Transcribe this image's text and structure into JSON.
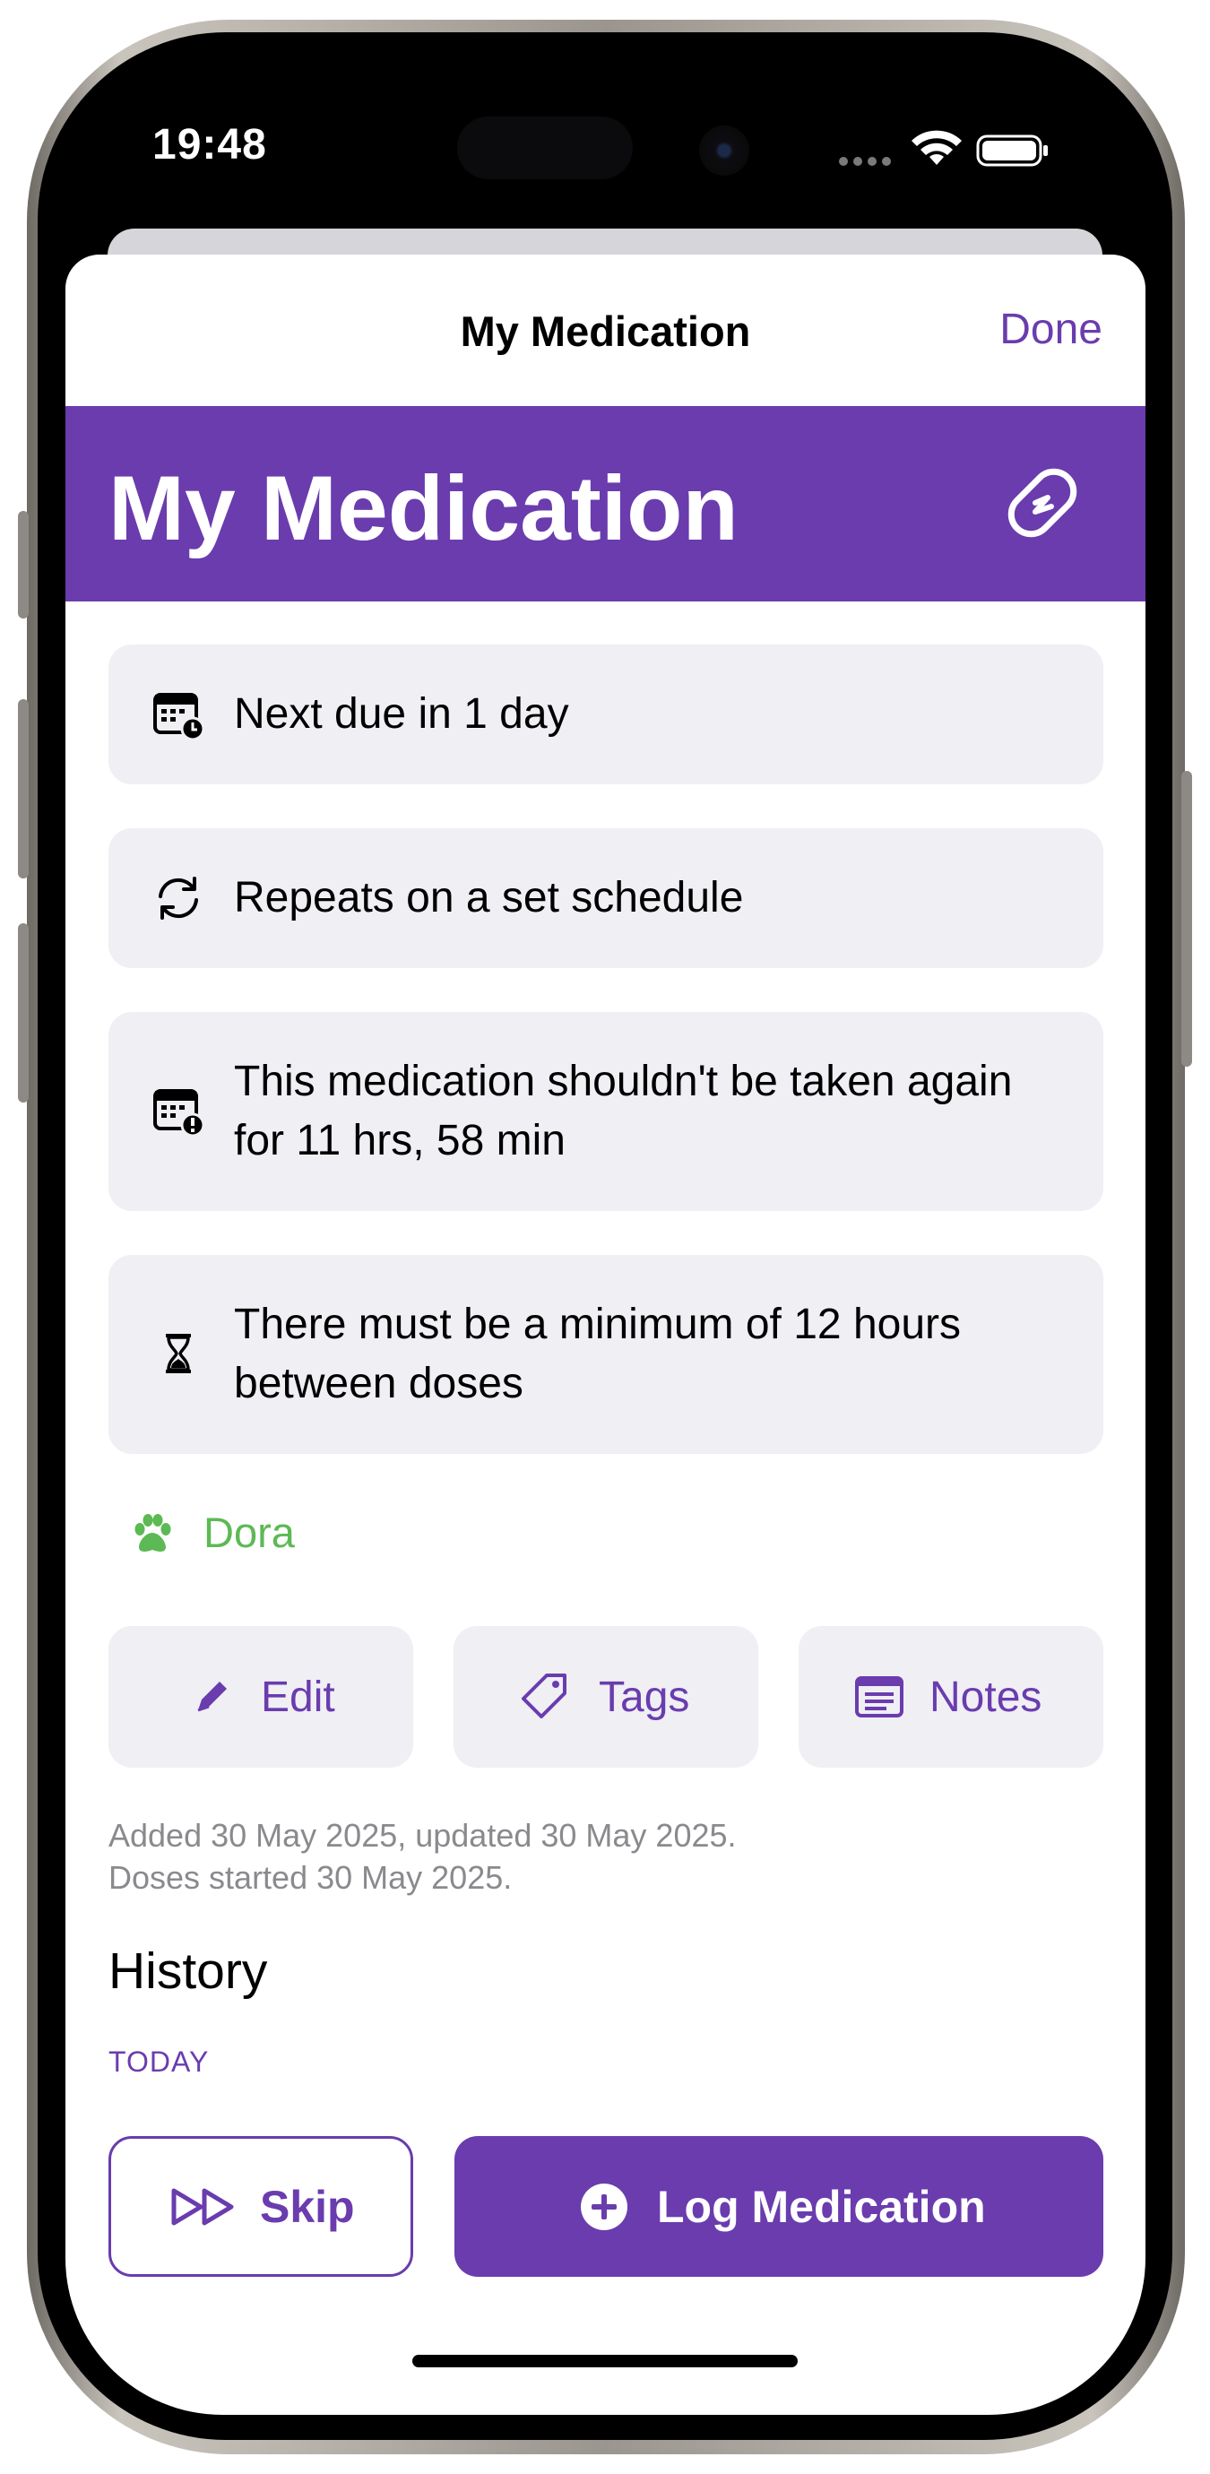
{
  "status_bar": {
    "time": "19:48"
  },
  "nav": {
    "title": "My Medication",
    "done_label": "Done"
  },
  "header": {
    "title": "My Medication",
    "icon": "pill-icon",
    "color": "#6a3cae"
  },
  "info_cards": [
    {
      "icon": "calendar-clock-icon",
      "text": "Next due in 1 day"
    },
    {
      "icon": "repeat-icon",
      "text": "Repeats on a set schedule"
    },
    {
      "icon": "calendar-alert-icon",
      "text": "This medication shouldn't be taken again for 11 hrs, 58 min"
    },
    {
      "icon": "hourglass-icon",
      "text": "There must be a minimum of 12 hours between doses"
    }
  ],
  "pet": {
    "name": "Dora",
    "icon": "paw-icon",
    "color": "#5db954"
  },
  "actions": {
    "edit_label": "Edit",
    "tags_label": "Tags",
    "notes_label": "Notes"
  },
  "meta": {
    "added_line": "Added 30 May 2025, updated 30 May 2025.",
    "doses_line": "Doses started 30 May 2025."
  },
  "history": {
    "title": "History",
    "section_label": "TODAY"
  },
  "footer": {
    "skip_label": "Skip",
    "log_label": "Log Medication"
  }
}
